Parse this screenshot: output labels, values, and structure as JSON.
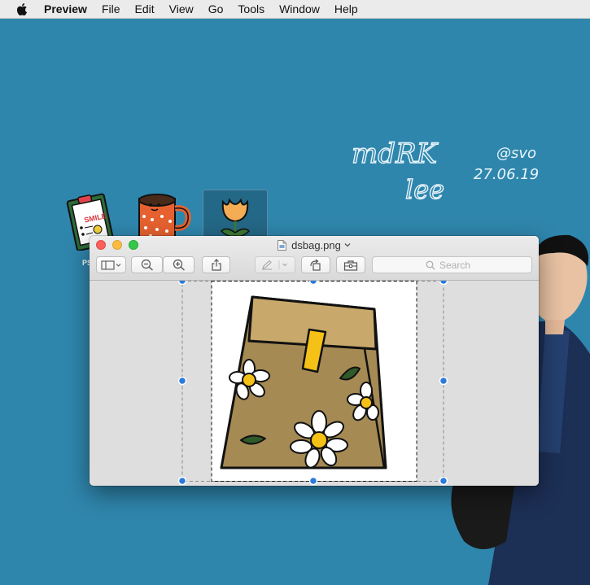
{
  "menubar": {
    "apple_icon": "apple-logo-icon",
    "items": [
      "Preview",
      "File",
      "Edit",
      "View",
      "Go",
      "Tools",
      "Window",
      "Help"
    ]
  },
  "desktop": {
    "background_color": "#2f86ad",
    "icons": [
      {
        "name": "smile-clipboard",
        "label": "PS"
      },
      {
        "name": "coffee-mug"
      },
      {
        "name": "tulip-flower"
      }
    ],
    "handwriting": {
      "name_line1": "mdRK",
      "name_line2": "lee",
      "tag": "@svo",
      "date": "27.06.19"
    }
  },
  "window": {
    "title": "dsbag.png",
    "title_icon": "png-document-icon",
    "toolbar": {
      "sidebar_button": "sidebar-icon",
      "zoom_out": "zoom-out-icon",
      "zoom_in": "zoom-in-icon",
      "share": "share-icon",
      "markup": "pen-icon",
      "rotate": "rotate-icon",
      "toolbox": "toolbox-icon",
      "search_placeholder": "Search"
    },
    "image": {
      "subject": "paper bag with daisies",
      "colors": {
        "bag": "#a58a54",
        "flap": "#c8a96b",
        "clasp": "#f5c117",
        "daisy": "#ffffff",
        "daisy_center": "#f5c117",
        "leaf": "#2f5a2a"
      }
    }
  }
}
